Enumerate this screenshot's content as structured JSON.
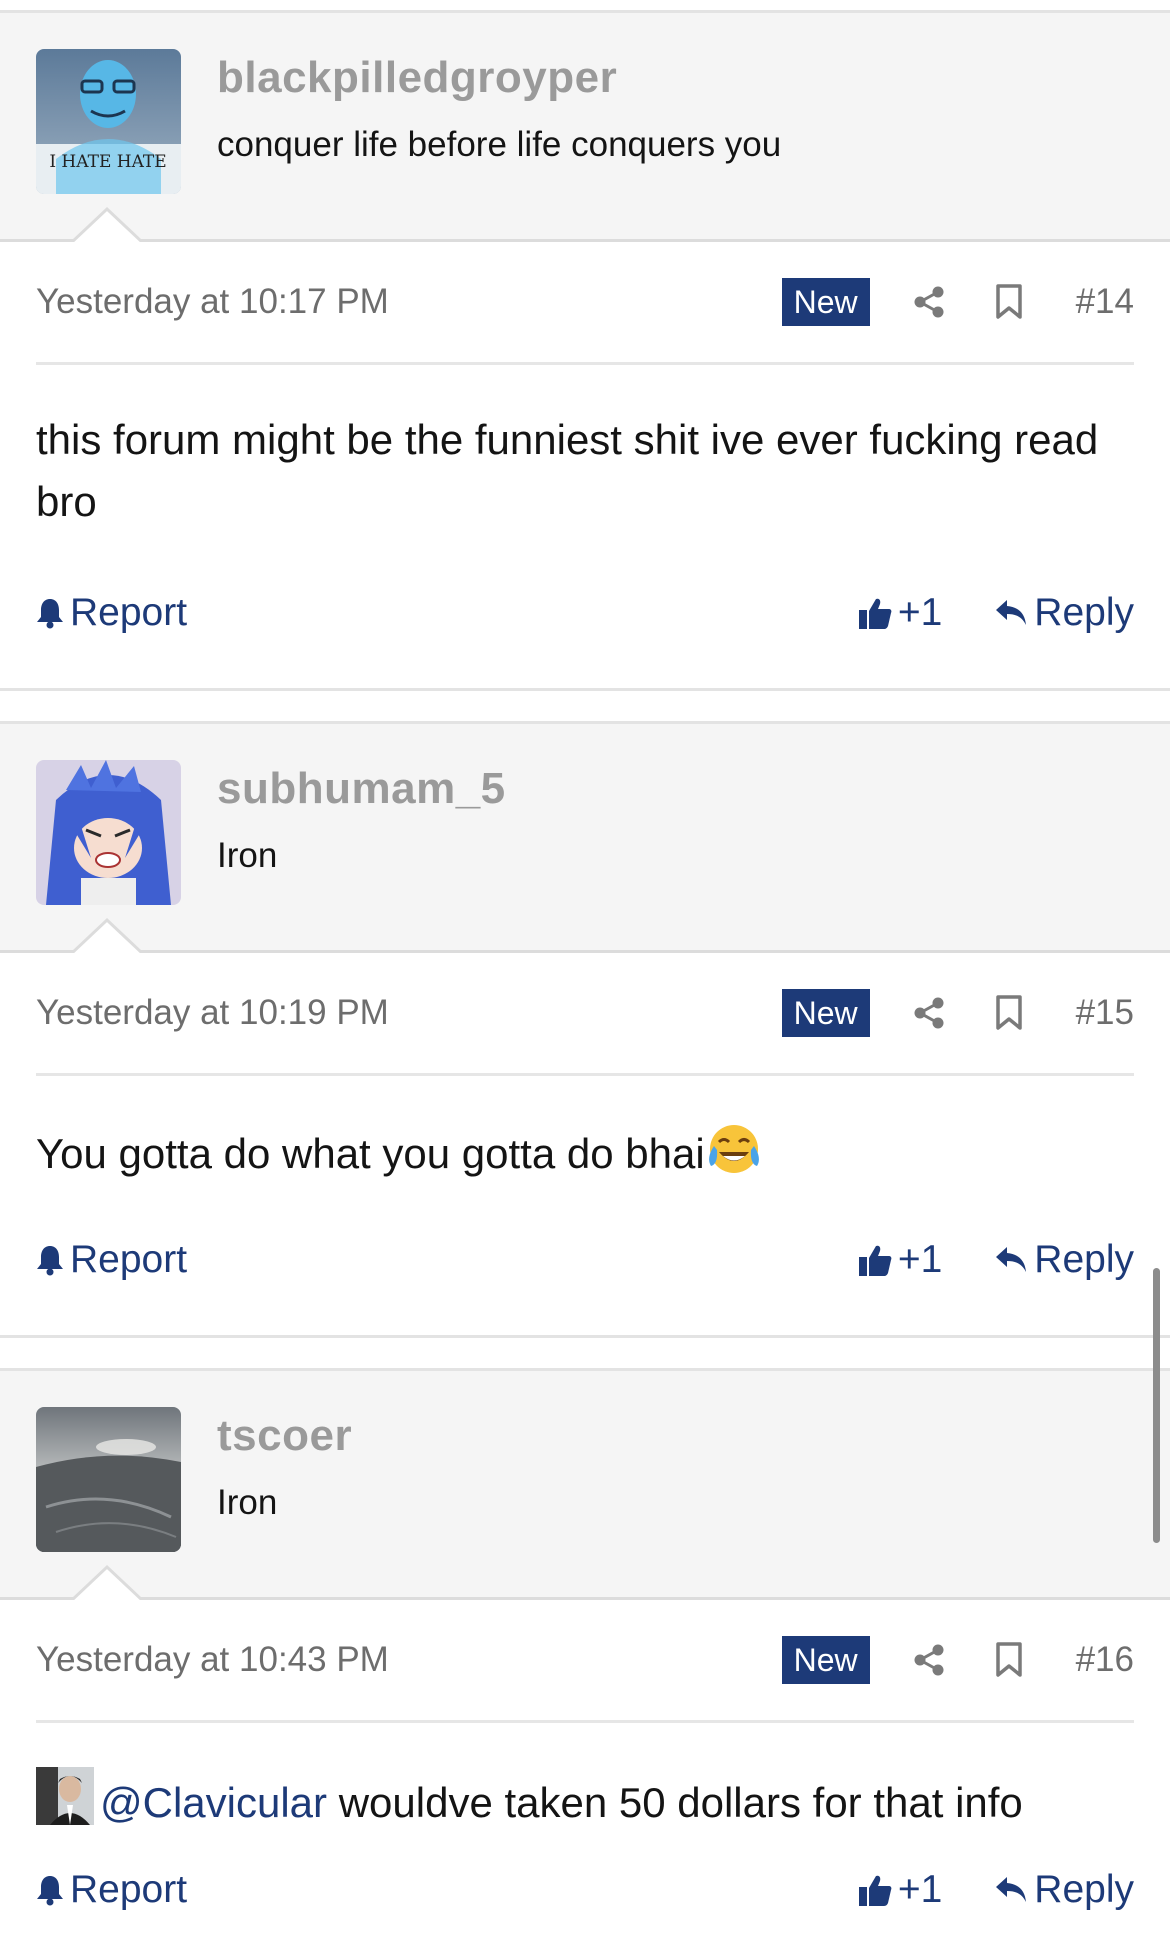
{
  "posts": [
    {
      "username": "blackpilledgroyper",
      "user_title": "conquer life before life conquers you",
      "avatar_caption": "I HATE HATE",
      "timestamp": "Yesterday at 10:17 PM",
      "badge": "New",
      "post_number": "#14",
      "body": "this forum might be the funniest shit ive ever fucking read bro",
      "report_label": "Report",
      "like_label": "+1",
      "reply_label": "Reply"
    },
    {
      "username": "subhumam_5",
      "user_title": "Iron",
      "timestamp": "Yesterday at 10:19 PM",
      "badge": "New",
      "post_number": "#15",
      "body": "You gotta do what you gotta do bhai",
      "emoji": "face-with-tears-of-joy",
      "report_label": "Report",
      "like_label": "+1",
      "reply_label": "Reply"
    },
    {
      "username": "tscoer",
      "user_title": "Iron",
      "timestamp": "Yesterday at 10:43 PM",
      "badge": "New",
      "post_number": "#16",
      "mention": "@Clavicular",
      "body": " wouldve taken 50 dollars for that info",
      "report_label": "Report",
      "like_label": "+1",
      "reply_label": "Reply"
    }
  ],
  "colors": {
    "accent": "#1d3a78",
    "username": "#9a9a9a",
    "header_bg": "#f5f5f5",
    "meta_text": "#6d6d6d"
  },
  "icons": [
    "share-icon",
    "bookmark-icon",
    "bell-icon",
    "thumbs-up-icon",
    "reply-arrow-icon"
  ]
}
